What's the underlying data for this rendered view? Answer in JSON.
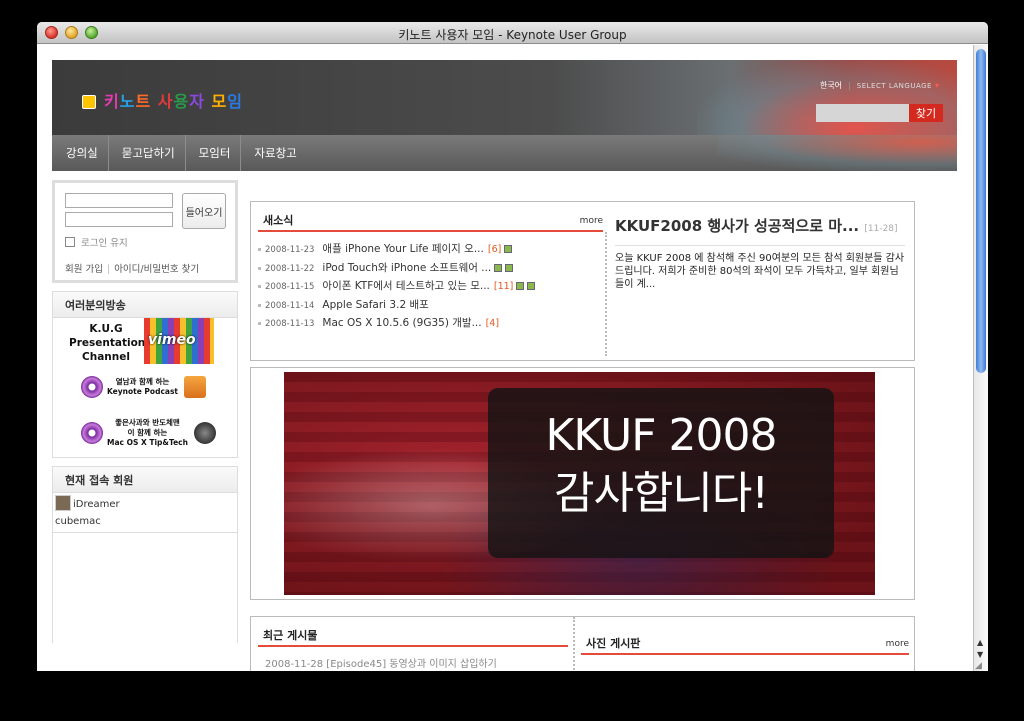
{
  "window": {
    "title": "키노트 사용자 모임 - Keynote User Group"
  },
  "header": {
    "logo_text": "키노트 사용자 모임",
    "lang_current": "한국어",
    "lang_select": "SELECT LANGUAGE",
    "search_button": "찾기"
  },
  "nav": {
    "items": [
      "강의실",
      "묻고답하기",
      "모임터",
      "자료창고"
    ]
  },
  "login": {
    "button": "들어오기",
    "keep": "로그인 유지",
    "signup": "회원 가입",
    "find": "아이디/비밀번호 찾기"
  },
  "broadcast": {
    "title": "여러분의방송",
    "kug": "K.U.G Presentation Channel",
    "vimeo": "vimeo",
    "podcast1_line1": "열남과 함께 하는",
    "podcast1_line2": "Keynote Podcast",
    "podcast2_line1": "좋은사과와 반도체맨",
    "podcast2_line2": "이 함께 하는",
    "podcast2_line3": "Mac OS X Tip&Tech"
  },
  "members": {
    "title": "현재 접속 회원",
    "list": [
      "iDreamer",
      "cubemac"
    ]
  },
  "news": {
    "title": "새소식",
    "more": "more",
    "items": [
      {
        "date": "2008-11-23",
        "text": "애플 iPhone Your Life 페이지 오...",
        "count": "[6]"
      },
      {
        "date": "2008-11-22",
        "text": "iPod Touch와 iPhone 소프트웨어 ...",
        "count": ""
      },
      {
        "date": "2008-11-15",
        "text": "아이폰 KTF에서 테스트하고 있는 모...",
        "count": "[11]"
      },
      {
        "date": "2008-11-14",
        "text": "Apple Safari 3.2 배포",
        "count": ""
      },
      {
        "date": "2008-11-13",
        "text": "Mac OS X 10.5.6 (9G35) 개발...",
        "count": "[4]"
      }
    ]
  },
  "featured": {
    "title": "KKUF2008 행사가 성공적으로 마...",
    "date": "[11-28]",
    "summary": "오늘 KKUF 2008 에 참석해 주신 90여분의 모든 참석 회원분들 감사드립니다. 저희가 준비한 80석의 좌석이 모두 가득차고, 일부 회원님들이 계..."
  },
  "banner": {
    "line1": "KKUF 2008",
    "line2": "감사합니다!"
  },
  "recent": {
    "title": "최근 게시물",
    "cut": "2008-11-28 [Episode45] 동영상과 이미지 삽입하기"
  },
  "photo_board": {
    "title": "사진 게시판",
    "more": "more"
  }
}
